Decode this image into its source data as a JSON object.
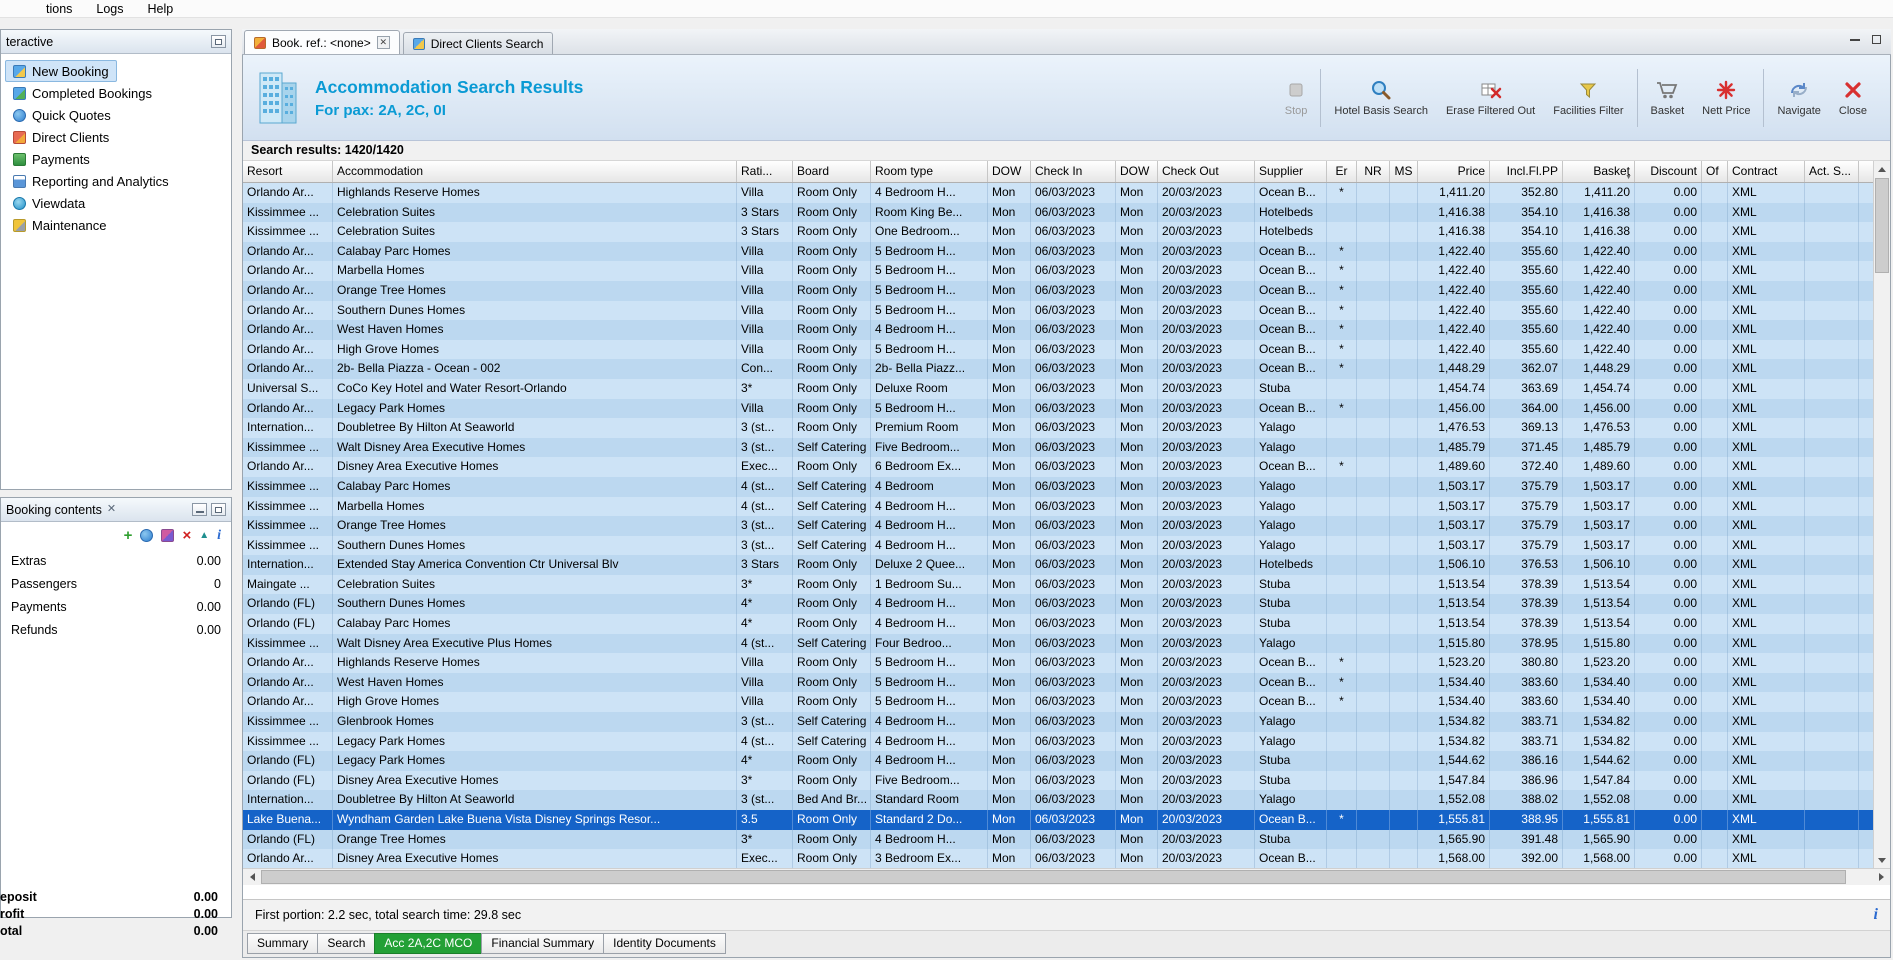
{
  "menu": {
    "items": [
      "tions",
      "Logs",
      "Help"
    ]
  },
  "sidebar": {
    "title": "teractive",
    "items": [
      {
        "label": "New Booking",
        "icon": "new-booking-icon",
        "selected": true
      },
      {
        "label": "Completed Bookings",
        "icon": "completed-bookings-icon",
        "selected": false
      },
      {
        "label": "Quick Quotes",
        "icon": "quick-quotes-icon",
        "selected": false
      },
      {
        "label": "Direct Clients",
        "icon": "direct-clients-icon",
        "selected": false
      },
      {
        "label": "Payments",
        "icon": "payments-icon",
        "selected": false
      },
      {
        "label": "Reporting and Analytics",
        "icon": "reporting-analytics-icon",
        "selected": false
      },
      {
        "label": "Viewdata",
        "icon": "viewdata-icon",
        "selected": false
      },
      {
        "label": "Maintenance",
        "icon": "maintenance-icon",
        "selected": false
      }
    ]
  },
  "booking_contents": {
    "title": "Booking contents",
    "rows": [
      {
        "label": "Extras",
        "value": "0.00"
      },
      {
        "label": "Passengers",
        "value": "0"
      },
      {
        "label": "Payments",
        "value": "0.00"
      },
      {
        "label": "Refunds",
        "value": "0.00"
      }
    ]
  },
  "totals": {
    "rows": [
      {
        "label": "eposit",
        "value": "0.00"
      },
      {
        "label": "rofit",
        "value": "0.00"
      },
      {
        "label": "otal",
        "value": "0.00"
      }
    ]
  },
  "workspace_tabs": [
    {
      "label": "Book. ref.: <none>",
      "active": true
    },
    {
      "label": "Direct Clients Search",
      "active": false
    }
  ],
  "header": {
    "title": "Accommodation Search Results",
    "subtitle": "For pax: 2A, 2C, 0I",
    "toolbar": [
      {
        "label": "Stop",
        "icon": "stop-icon",
        "disabled": true
      },
      {
        "label": "Hotel Basis Search",
        "icon": "hotel-basis-search-icon",
        "disabled": false
      },
      {
        "label": "Erase Filtered Out",
        "icon": "erase-filtered-out-icon",
        "disabled": false
      },
      {
        "label": "Facilities Filter",
        "icon": "facilities-filter-icon",
        "disabled": false
      },
      {
        "label": "Basket",
        "icon": "basket-icon",
        "disabled": false
      },
      {
        "label": "Nett Price",
        "icon": "nett-price-icon",
        "disabled": false
      },
      {
        "label": "Navigate",
        "icon": "navigate-icon",
        "disabled": false
      },
      {
        "label": "Close",
        "icon": "close-icon",
        "disabled": false
      }
    ]
  },
  "results": {
    "summary": "Search results: 1420/1420",
    "columns": [
      "Resort",
      "Accommodation",
      "Rati...",
      "Board",
      "Room type",
      "DOW",
      "Check In",
      "DOW",
      "Check Out",
      "Supplier",
      "Er",
      "NR",
      "MS",
      "Price",
      "Incl.Fl.PP",
      "Basket",
      "Discount",
      "Of",
      "Contract",
      "Act. S..."
    ],
    "selected_index": 32,
    "status": "First portion: 2.2 sec, total search time: 29.8 sec",
    "rows": [
      [
        "Orlando Ar...",
        "Highlands Reserve Homes",
        "Villa",
        "Room Only",
        "4 Bedroom H...",
        "Mon",
        "06/03/2023",
        "Mon",
        "20/03/2023",
        "Ocean B...",
        "*",
        "",
        "",
        "1,411.20",
        "352.80",
        "1,411.20",
        "0.00",
        "",
        "XML",
        ""
      ],
      [
        "Kissimmee ...",
        "Celebration Suites",
        "3 Stars",
        "Room Only",
        "Room King Be...",
        "Mon",
        "06/03/2023",
        "Mon",
        "20/03/2023",
        "Hotelbeds",
        "",
        "",
        "",
        "1,416.38",
        "354.10",
        "1,416.38",
        "0.00",
        "",
        "XML",
        ""
      ],
      [
        "Kissimmee ...",
        "Celebration Suites",
        "3 Stars",
        "Room Only",
        "One Bedroom...",
        "Mon",
        "06/03/2023",
        "Mon",
        "20/03/2023",
        "Hotelbeds",
        "",
        "",
        "",
        "1,416.38",
        "354.10",
        "1,416.38",
        "0.00",
        "",
        "XML",
        ""
      ],
      [
        "Orlando Ar...",
        "Calabay Parc Homes",
        "Villa",
        "Room Only",
        "5 Bedroom H...",
        "Mon",
        "06/03/2023",
        "Mon",
        "20/03/2023",
        "Ocean B...",
        "*",
        "",
        "",
        "1,422.40",
        "355.60",
        "1,422.40",
        "0.00",
        "",
        "XML",
        ""
      ],
      [
        "Orlando Ar...",
        "Marbella Homes",
        "Villa",
        "Room Only",
        "5 Bedroom H...",
        "Mon",
        "06/03/2023",
        "Mon",
        "20/03/2023",
        "Ocean B...",
        "*",
        "",
        "",
        "1,422.40",
        "355.60",
        "1,422.40",
        "0.00",
        "",
        "XML",
        ""
      ],
      [
        "Orlando Ar...",
        "Orange Tree Homes",
        "Villa",
        "Room Only",
        "5 Bedroom H...",
        "Mon",
        "06/03/2023",
        "Mon",
        "20/03/2023",
        "Ocean B...",
        "*",
        "",
        "",
        "1,422.40",
        "355.60",
        "1,422.40",
        "0.00",
        "",
        "XML",
        ""
      ],
      [
        "Orlando Ar...",
        "Southern Dunes Homes",
        "Villa",
        "Room Only",
        "5 Bedroom H...",
        "Mon",
        "06/03/2023",
        "Mon",
        "20/03/2023",
        "Ocean B...",
        "*",
        "",
        "",
        "1,422.40",
        "355.60",
        "1,422.40",
        "0.00",
        "",
        "XML",
        ""
      ],
      [
        "Orlando Ar...",
        "West Haven Homes",
        "Villa",
        "Room Only",
        "4 Bedroom H...",
        "Mon",
        "06/03/2023",
        "Mon",
        "20/03/2023",
        "Ocean B...",
        "*",
        "",
        "",
        "1,422.40",
        "355.60",
        "1,422.40",
        "0.00",
        "",
        "XML",
        ""
      ],
      [
        "Orlando Ar...",
        "High Grove Homes",
        "Villa",
        "Room Only",
        "5 Bedroom H...",
        "Mon",
        "06/03/2023",
        "Mon",
        "20/03/2023",
        "Ocean B...",
        "*",
        "",
        "",
        "1,422.40",
        "355.60",
        "1,422.40",
        "0.00",
        "",
        "XML",
        ""
      ],
      [
        "Orlando Ar...",
        "2b- Bella Piazza - Ocean - 002",
        "Con...",
        "Room Only",
        "2b- Bella Piazz...",
        "Mon",
        "06/03/2023",
        "Mon",
        "20/03/2023",
        "Ocean B...",
        "*",
        "",
        "",
        "1,448.29",
        "362.07",
        "1,448.29",
        "0.00",
        "",
        "XML",
        ""
      ],
      [
        "Universal S...",
        "CoCo Key Hotel and Water Resort-Orlando",
        "3*",
        "Room Only",
        "Deluxe Room",
        "Mon",
        "06/03/2023",
        "Mon",
        "20/03/2023",
        "Stuba",
        "",
        "",
        "",
        "1,454.74",
        "363.69",
        "1,454.74",
        "0.00",
        "",
        "XML",
        ""
      ],
      [
        "Orlando Ar...",
        "Legacy Park Homes",
        "Villa",
        "Room Only",
        "5 Bedroom H...",
        "Mon",
        "06/03/2023",
        "Mon",
        "20/03/2023",
        "Ocean B...",
        "*",
        "",
        "",
        "1,456.00",
        "364.00",
        "1,456.00",
        "0.00",
        "",
        "XML",
        ""
      ],
      [
        "Internation...",
        "Doubletree By Hilton At Seaworld",
        "3 (st...",
        "Room Only",
        "Premium Room",
        "Mon",
        "06/03/2023",
        "Mon",
        "20/03/2023",
        "Yalago",
        "",
        "",
        "",
        "1,476.53",
        "369.13",
        "1,476.53",
        "0.00",
        "",
        "XML",
        ""
      ],
      [
        "Kissimmee ...",
        "Walt Disney Area Executive Homes",
        "3 (st...",
        "Self Catering",
        "Five Bedroom...",
        "Mon",
        "06/03/2023",
        "Mon",
        "20/03/2023",
        "Yalago",
        "",
        "",
        "",
        "1,485.79",
        "371.45",
        "1,485.79",
        "0.00",
        "",
        "XML",
        ""
      ],
      [
        "Orlando Ar...",
        "Disney Area Executive Homes",
        "Exec...",
        "Room Only",
        "6 Bedroom Ex...",
        "Mon",
        "06/03/2023",
        "Mon",
        "20/03/2023",
        "Ocean B...",
        "*",
        "",
        "",
        "1,489.60",
        "372.40",
        "1,489.60",
        "0.00",
        "",
        "XML",
        ""
      ],
      [
        "Kissimmee ...",
        "Calabay Parc Homes",
        "4 (st...",
        "Self Catering",
        "4 Bedroom",
        "Mon",
        "06/03/2023",
        "Mon",
        "20/03/2023",
        "Yalago",
        "",
        "",
        "",
        "1,503.17",
        "375.79",
        "1,503.17",
        "0.00",
        "",
        "XML",
        ""
      ],
      [
        "Kissimmee ...",
        "Marbella Homes",
        "4 (st...",
        "Self Catering",
        "4 Bedroom H...",
        "Mon",
        "06/03/2023",
        "Mon",
        "20/03/2023",
        "Yalago",
        "",
        "",
        "",
        "1,503.17",
        "375.79",
        "1,503.17",
        "0.00",
        "",
        "XML",
        ""
      ],
      [
        "Kissimmee ...",
        "Orange Tree Homes",
        "3 (st...",
        "Self Catering",
        "4 Bedroom H...",
        "Mon",
        "06/03/2023",
        "Mon",
        "20/03/2023",
        "Yalago",
        "",
        "",
        "",
        "1,503.17",
        "375.79",
        "1,503.17",
        "0.00",
        "",
        "XML",
        ""
      ],
      [
        "Kissimmee ...",
        "Southern Dunes Homes",
        "3 (st...",
        "Self Catering",
        "4 Bedroom H...",
        "Mon",
        "06/03/2023",
        "Mon",
        "20/03/2023",
        "Yalago",
        "",
        "",
        "",
        "1,503.17",
        "375.79",
        "1,503.17",
        "0.00",
        "",
        "XML",
        ""
      ],
      [
        "Internation...",
        "Extended Stay America Convention Ctr Universal Blv",
        "3 Stars",
        "Room Only",
        "Deluxe 2 Quee...",
        "Mon",
        "06/03/2023",
        "Mon",
        "20/03/2023",
        "Hotelbeds",
        "",
        "",
        "",
        "1,506.10",
        "376.53",
        "1,506.10",
        "0.00",
        "",
        "XML",
        ""
      ],
      [
        "Maingate ...",
        "Celebration Suites",
        "3*",
        "Room Only",
        "1 Bedroom Su...",
        "Mon",
        "06/03/2023",
        "Mon",
        "20/03/2023",
        "Stuba",
        "",
        "",
        "",
        "1,513.54",
        "378.39",
        "1,513.54",
        "0.00",
        "",
        "XML",
        ""
      ],
      [
        "Orlando (FL)",
        "Southern Dunes Homes",
        "4*",
        "Room Only",
        "4 Bedroom H...",
        "Mon",
        "06/03/2023",
        "Mon",
        "20/03/2023",
        "Stuba",
        "",
        "",
        "",
        "1,513.54",
        "378.39",
        "1,513.54",
        "0.00",
        "",
        "XML",
        ""
      ],
      [
        "Orlando (FL)",
        "Calabay Parc Homes",
        "4*",
        "Room Only",
        "4 Bedroom H...",
        "Mon",
        "06/03/2023",
        "Mon",
        "20/03/2023",
        "Stuba",
        "",
        "",
        "",
        "1,513.54",
        "378.39",
        "1,513.54",
        "0.00",
        "",
        "XML",
        ""
      ],
      [
        "Kissimmee ...",
        "Walt Disney Area Executive Plus Homes",
        "4 (st...",
        "Self Catering",
        "Four Bedroo...",
        "Mon",
        "06/03/2023",
        "Mon",
        "20/03/2023",
        "Yalago",
        "",
        "",
        "",
        "1,515.80",
        "378.95",
        "1,515.80",
        "0.00",
        "",
        "XML",
        ""
      ],
      [
        "Orlando Ar...",
        "Highlands Reserve Homes",
        "Villa",
        "Room Only",
        "5 Bedroom H...",
        "Mon",
        "06/03/2023",
        "Mon",
        "20/03/2023",
        "Ocean B...",
        "*",
        "",
        "",
        "1,523.20",
        "380.80",
        "1,523.20",
        "0.00",
        "",
        "XML",
        ""
      ],
      [
        "Orlando Ar...",
        "West Haven Homes",
        "Villa",
        "Room Only",
        "5 Bedroom H...",
        "Mon",
        "06/03/2023",
        "Mon",
        "20/03/2023",
        "Ocean B...",
        "*",
        "",
        "",
        "1,534.40",
        "383.60",
        "1,534.40",
        "0.00",
        "",
        "XML",
        ""
      ],
      [
        "Orlando Ar...",
        "High Grove Homes",
        "Villa",
        "Room Only",
        "5 Bedroom H...",
        "Mon",
        "06/03/2023",
        "Mon",
        "20/03/2023",
        "Ocean B...",
        "*",
        "",
        "",
        "1,534.40",
        "383.60",
        "1,534.40",
        "0.00",
        "",
        "XML",
        ""
      ],
      [
        "Kissimmee ...",
        "Glenbrook Homes",
        "3 (st...",
        "Self Catering",
        "4 Bedroom H...",
        "Mon",
        "06/03/2023",
        "Mon",
        "20/03/2023",
        "Yalago",
        "",
        "",
        "",
        "1,534.82",
        "383.71",
        "1,534.82",
        "0.00",
        "",
        "XML",
        ""
      ],
      [
        "Kissimmee ...",
        "Legacy Park Homes",
        "4 (st...",
        "Self Catering",
        "4 Bedroom H...",
        "Mon",
        "06/03/2023",
        "Mon",
        "20/03/2023",
        "Yalago",
        "",
        "",
        "",
        "1,534.82",
        "383.71",
        "1,534.82",
        "0.00",
        "",
        "XML",
        ""
      ],
      [
        "Orlando (FL)",
        "Legacy Park Homes",
        "4*",
        "Room Only",
        "4 Bedroom H...",
        "Mon",
        "06/03/2023",
        "Mon",
        "20/03/2023",
        "Stuba",
        "",
        "",
        "",
        "1,544.62",
        "386.16",
        "1,544.62",
        "0.00",
        "",
        "XML",
        ""
      ],
      [
        "Orlando (FL)",
        "Disney Area Executive Homes",
        "3*",
        "Room Only",
        "Five Bedroom...",
        "Mon",
        "06/03/2023",
        "Mon",
        "20/03/2023",
        "Stuba",
        "",
        "",
        "",
        "1,547.84",
        "386.96",
        "1,547.84",
        "0.00",
        "",
        "XML",
        ""
      ],
      [
        "Internation...",
        "Doubletree By Hilton At Seaworld",
        "3 (st...",
        "Bed And Br...",
        "Standard Room",
        "Mon",
        "06/03/2023",
        "Mon",
        "20/03/2023",
        "Yalago",
        "",
        "",
        "",
        "1,552.08",
        "388.02",
        "1,552.08",
        "0.00",
        "",
        "XML",
        ""
      ],
      [
        "Lake Buena...",
        "Wyndham Garden Lake Buena Vista Disney Springs Resor...",
        "3.5",
        "Room Only",
        "Standard 2 Do...",
        "Mon",
        "06/03/2023",
        "Mon",
        "20/03/2023",
        "Ocean B...",
        "*",
        "",
        "",
        "1,555.81",
        "388.95",
        "1,555.81",
        "0.00",
        "",
        "XML",
        ""
      ],
      [
        "Orlando (FL)",
        "Orange Tree Homes",
        "3*",
        "Room Only",
        "4 Bedroom H...",
        "Mon",
        "06/03/2023",
        "Mon",
        "20/03/2023",
        "Stuba",
        "",
        "",
        "",
        "1,565.90",
        "391.48",
        "1,565.90",
        "0.00",
        "",
        "XML",
        ""
      ],
      [
        "Orlando Ar...",
        "Disney Area Executive Homes",
        "Exec...",
        "Room Only",
        "3 Bedroom Ex...",
        "Mon",
        "06/03/2023",
        "Mon",
        "20/03/2023",
        "Ocean B...",
        "",
        "",
        "",
        "1,568.00",
        "392.00",
        "1,568.00",
        "0.00",
        "",
        "XML",
        ""
      ]
    ]
  },
  "bottom_tabs": [
    {
      "label": "Summary",
      "active": false
    },
    {
      "label": "Search",
      "active": false
    },
    {
      "label": "Acc 2A,2C MCO",
      "active": true
    },
    {
      "label": "Financial Summary",
      "active": false
    },
    {
      "label": "Identity Documents",
      "active": false
    }
  ],
  "colors": {
    "accent_title": "#0a9ad4",
    "selected_row": "#1563c8",
    "active_bottom_tab_green": "#23a036",
    "row_alt_light": "#cde3f6",
    "row_alt_dark": "#bcd8f0"
  }
}
